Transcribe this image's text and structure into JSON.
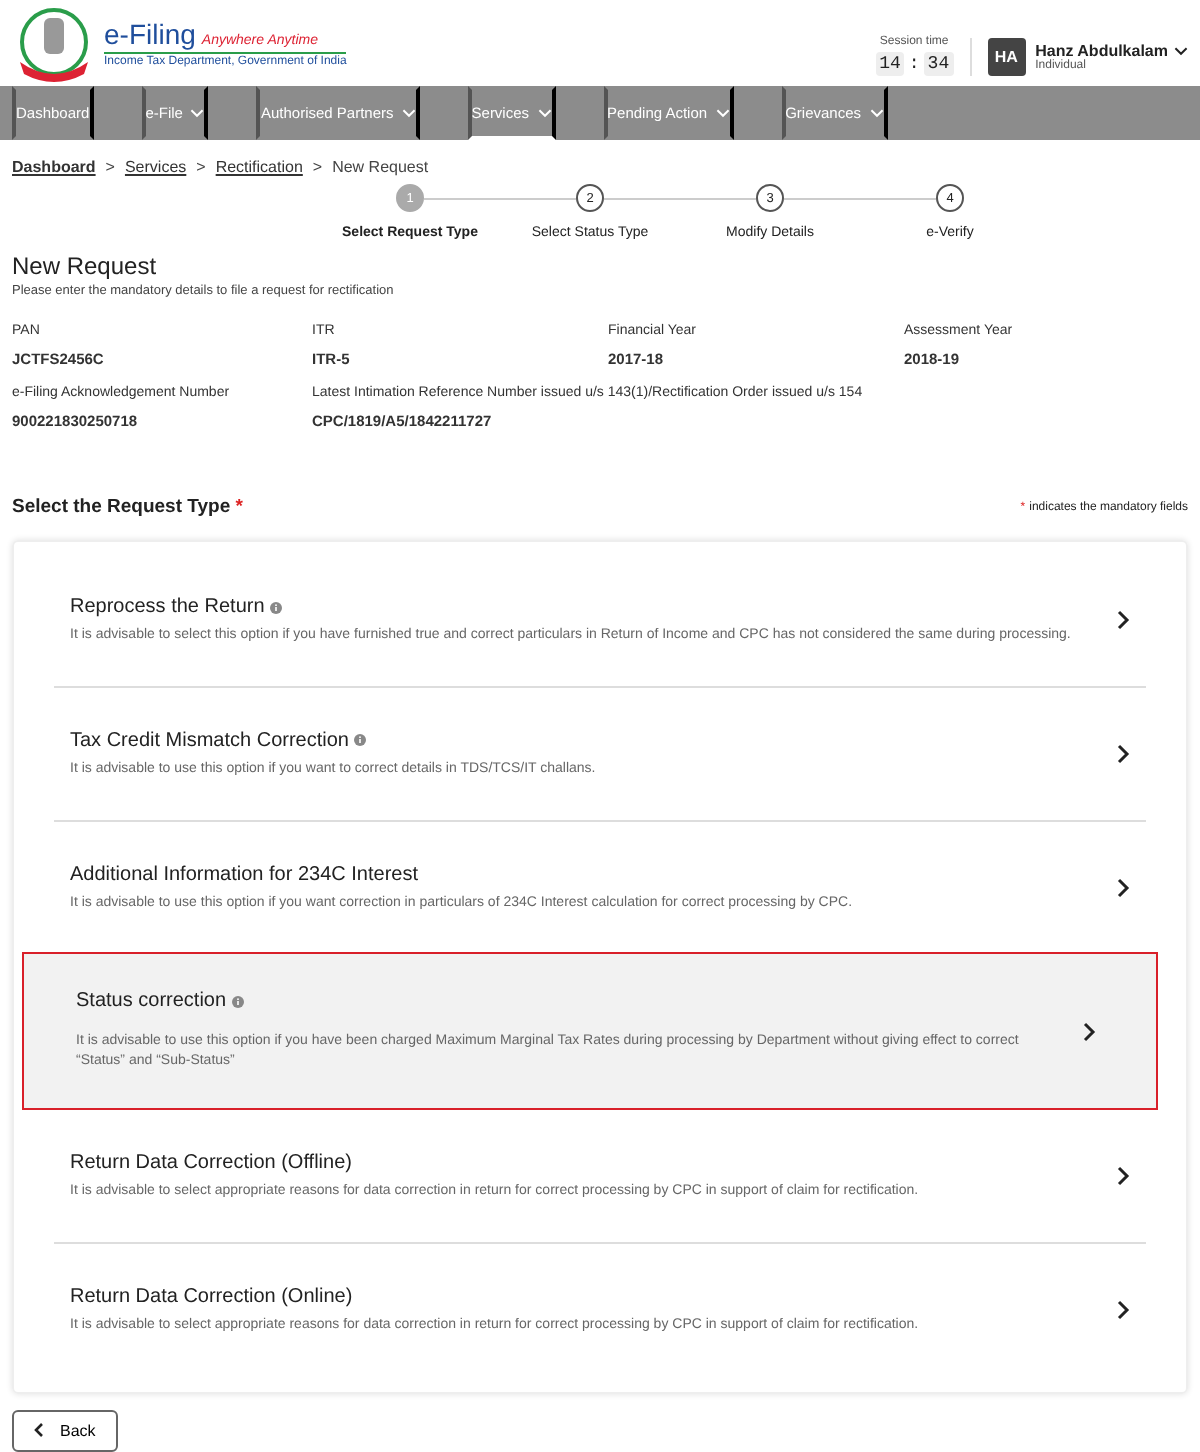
{
  "header": {
    "logo_title": "e-Filing",
    "logo_tagline": "Anywhere Anytime",
    "logo_subtitle": "Income Tax Department, Government of India",
    "session_label": "Session time",
    "session_minutes": "14",
    "session_separator": ":",
    "session_seconds": "34",
    "avatar_initials": "HA",
    "user_name": "Hanz Abdulkalam",
    "user_role": "Individual"
  },
  "nav": [
    {
      "label": "Dashboard",
      "has_menu": false,
      "selected": false
    },
    {
      "label": "e-File",
      "has_menu": true,
      "selected": false
    },
    {
      "label": "Authorised Partners",
      "has_menu": true,
      "selected": false
    },
    {
      "label": "Services",
      "has_menu": true,
      "selected": true
    },
    {
      "label": "Pending Action",
      "has_menu": true,
      "selected": false
    },
    {
      "label": "Grievances",
      "has_menu": true,
      "selected": false
    }
  ],
  "breadcrumb": [
    {
      "label": "Dashboard",
      "link": true
    },
    {
      "separator": ">",
      "label": "Services",
      "link": true
    },
    {
      "separator": ">",
      "label": "Rectification",
      "link": true
    },
    {
      "separator": ">",
      "label": "New Request",
      "link": false
    }
  ],
  "steps": [
    {
      "number": "1",
      "label": "Select Request Type",
      "current": true
    },
    {
      "number": "2",
      "label": "Select Status Type",
      "current": false
    },
    {
      "number": "3",
      "label": "Modify Details",
      "current": false
    },
    {
      "number": "4",
      "label": "e-Verify",
      "current": false
    }
  ],
  "page_title": "New Request",
  "page_subtitle": "Please enter the mandatory details to file a request for rectification",
  "details": [
    {
      "label": "PAN",
      "value": "JCTFS2456C"
    },
    {
      "label": "ITR",
      "value": "ITR-5"
    },
    {
      "label": "Financial Year",
      "value": "2017-18"
    },
    {
      "label": "Assessment Year",
      "value": "2018-19"
    },
    {
      "label": "e-Filing Acknowledgement Number",
      "value": "900221830250718"
    },
    {
      "label": "Latest Intimation Reference Number issued u/s 143(1)/Rectification Order issued u/s 154",
      "value": "CPC/1819/A5/1842211727"
    }
  ],
  "section_title": "Select the Request Type",
  "required_mark": "*",
  "mandatory_note_mark": "*",
  "mandatory_note": "indicates the mandatory fields",
  "options": [
    {
      "title": "Reprocess the Return",
      "info": true,
      "selected": false,
      "description": "It is advisable to select this option if you have furnished true and correct particulars in Return of Income and CPC has not considered the same during processing."
    },
    {
      "title": "Tax Credit Mismatch Correction",
      "info": true,
      "selected": false,
      "description": "It is advisable to use this option if you want to correct details in TDS/TCS/IT challans."
    },
    {
      "title": "Additional Information for 234C Interest",
      "info": false,
      "selected": false,
      "description": "It is advisable to use this option if you want correction in particulars of 234C Interest calculation for correct processing by CPC."
    },
    {
      "title": "Status correction",
      "info": true,
      "selected": true,
      "description": "It is advisable to use this option if you have been charged Maximum Marginal Tax Rates during processing by Department without giving effect to correct “Status” and “Sub-Status”"
    },
    {
      "title": "Return Data Correction (Offline)",
      "info": false,
      "selected": false,
      "description": "It is advisable to select appropriate reasons for data correction in return for correct processing by CPC in support of claim for rectification."
    },
    {
      "title": "Return Data Correction (Online)",
      "info": false,
      "selected": false,
      "description": "It is advisable to select appropriate reasons for data correction in return for correct processing by CPC in support of claim for rectification."
    }
  ],
  "back_button": "Back"
}
